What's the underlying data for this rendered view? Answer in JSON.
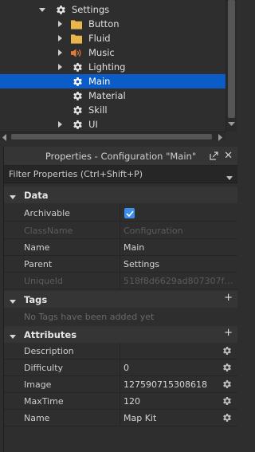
{
  "explorer": {
    "items": [
      {
        "label": "Settings",
        "icon": "gear-icon",
        "depth": 0,
        "expanded": true
      },
      {
        "label": "Button",
        "icon": "folder-icon",
        "depth": 1
      },
      {
        "label": "Fluid",
        "icon": "folder-icon",
        "depth": 1
      },
      {
        "label": "Music",
        "icon": "speaker-icon",
        "depth": 1
      },
      {
        "label": "Lighting",
        "icon": "gear-icon",
        "depth": 1
      },
      {
        "label": "Main",
        "icon": "gear-icon",
        "depth": 1,
        "selected": true
      },
      {
        "label": "Material",
        "icon": "gear-icon",
        "depth": 1
      },
      {
        "label": "Skill",
        "icon": "gear-icon",
        "depth": 1
      },
      {
        "label": "UI",
        "icon": "gear-icon",
        "depth": 0
      }
    ]
  },
  "properties": {
    "title": "Properties - Configuration \"Main\"",
    "filter_placeholder": "Filter Properties (Ctrl+Shift+P)",
    "sections": {
      "data": {
        "name": "Data",
        "rows": [
          {
            "key": "Archivable",
            "value": "",
            "checked": true
          },
          {
            "key": "ClassName",
            "value": "Configuration",
            "dim": true
          },
          {
            "key": "Name",
            "value": "Main"
          },
          {
            "key": "Parent",
            "value": "Settings"
          },
          {
            "key": "UniqueId",
            "value": "518f8d6629ad807307f39...",
            "dim": true
          }
        ]
      },
      "tags": {
        "name": "Tags",
        "empty_text": "No Tags have been added yet"
      },
      "attributes": {
        "name": "Attributes",
        "rows": [
          {
            "key": "Description",
            "value": ""
          },
          {
            "key": "Difficulty",
            "value": "0"
          },
          {
            "key": "Image",
            "value": "127590715308618"
          },
          {
            "key": "MaxTime",
            "value": "120"
          },
          {
            "key": "Name",
            "value": "Map Kit"
          }
        ]
      }
    }
  },
  "colors": {
    "selection": "#0b5cc7",
    "folder": "#e8b64a",
    "speaker": "#e07b39",
    "checkbox": "#3b8eea"
  }
}
